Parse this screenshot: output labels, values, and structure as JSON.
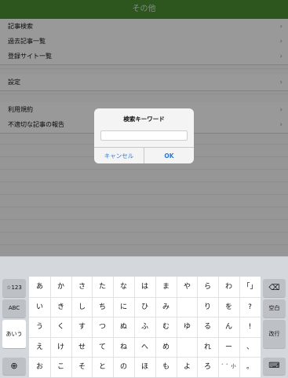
{
  "nav": {
    "title": "その他"
  },
  "menu": {
    "items": [
      {
        "label": "記事検索"
      },
      {
        "label": "過去記事一覧"
      },
      {
        "label": "登録サイト一覧"
      },
      {
        "label": "設定"
      },
      {
        "label": "利用規約"
      },
      {
        "label": "不適切な記事の報告"
      }
    ],
    "chevron": "›"
  },
  "dialog": {
    "title": "検索キーワード",
    "input_value": "",
    "cancel_label": "キャンセル",
    "ok_label": "OK"
  },
  "keyboard": {
    "left_keys": [
      "☆123",
      "ABC",
      "あいう",
      "⊕"
    ],
    "right_keys": [
      "⌫",
      "空白",
      "改行",
      "⌨"
    ],
    "kana_rows": [
      [
        "あ",
        "か",
        "さ",
        "た",
        "な",
        "は",
        "ま",
        "や",
        "ら",
        "わ",
        "「」"
      ],
      [
        "い",
        "き",
        "し",
        "ち",
        "に",
        "ひ",
        "み",
        "",
        "り",
        "を",
        "?"
      ],
      [
        "う",
        "く",
        "す",
        "つ",
        "ぬ",
        "ふ",
        "む",
        "ゆ",
        "る",
        "ん",
        "!"
      ],
      [
        "え",
        "け",
        "せ",
        "て",
        "ね",
        "へ",
        "め",
        "",
        "れ",
        "ー",
        "、"
      ],
      [
        "お",
        "こ",
        "そ",
        "と",
        "の",
        "ほ",
        "も",
        "よ",
        "ろ",
        "゛゜小",
        "。"
      ]
    ]
  }
}
